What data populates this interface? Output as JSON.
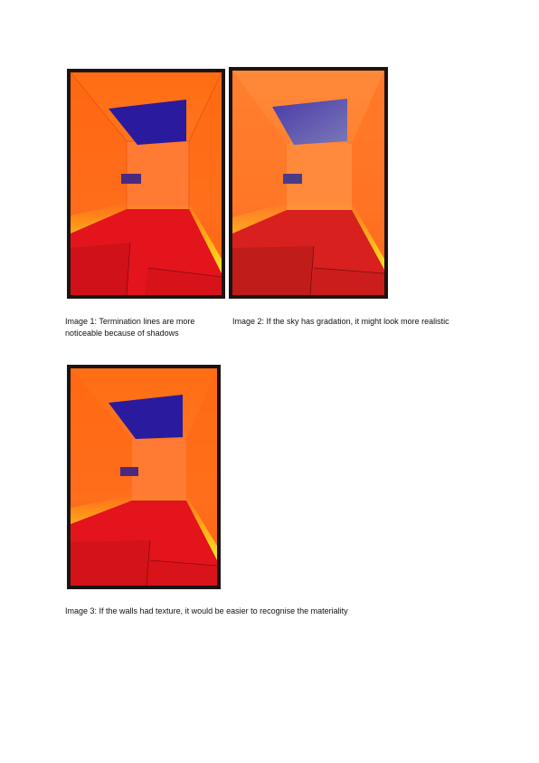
{
  "captions": {
    "image1": "Image 1: Termination lines are more noticeable because of shadows",
    "image2": "Image 2: If the sky has gradation, it might look more realistic",
    "image3": "Image 3: If the walls had texture, it would be easier to recognise the materiality"
  },
  "icons": {
    "image1": "room-render-image",
    "image2": "room-render-image",
    "image3": "room-render-image"
  },
  "colors": {
    "frame": "#1c1412",
    "wall": "#ff6a1a",
    "floor": "#e0141a",
    "glow": "#ffd21a",
    "sky": "#2a1a9a",
    "window": "#3a2a8a"
  }
}
